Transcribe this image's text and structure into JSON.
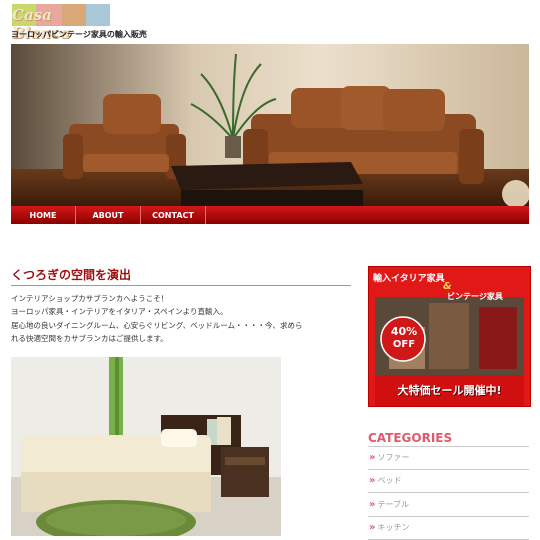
{
  "site": {
    "logo_text": "Casa Blanca",
    "tagline": "ヨーロッパビンテージ家具の輸入販売"
  },
  "nav": {
    "items": [
      {
        "label": "HOME"
      },
      {
        "label": "ABOUT"
      },
      {
        "label": "CONTACT"
      }
    ]
  },
  "main": {
    "title": "くつろぎの空間を演出",
    "intro_lines": [
      "インテリアショップカサブランカへようこそ！",
      "ヨーロッパ家具・インテリアをイタリア・スペインより直輸入。",
      "居心地の良いダイニングルーム、心安らぐリビング、ベッドルーム・・・・今、求めら",
      "れる快適空間をカサブランカはご提供します。"
    ]
  },
  "banner": {
    "line1": "輸入イタリア家具",
    "amp": "&",
    "line2": "ビンテージ家具",
    "discount": "40%",
    "discount_sub": "OFF",
    "sale_text": "大特価セール開催中!"
  },
  "sidebar": {
    "categories_title": "CATEGORIES",
    "categories": [
      {
        "label": "ソファー"
      },
      {
        "label": "ベッド"
      },
      {
        "label": "テーブル"
      },
      {
        "label": "キッチン"
      }
    ]
  },
  "colors": {
    "nav_red": "#c01010",
    "title_red": "#a01010",
    "category_pink": "#e05a6a"
  }
}
